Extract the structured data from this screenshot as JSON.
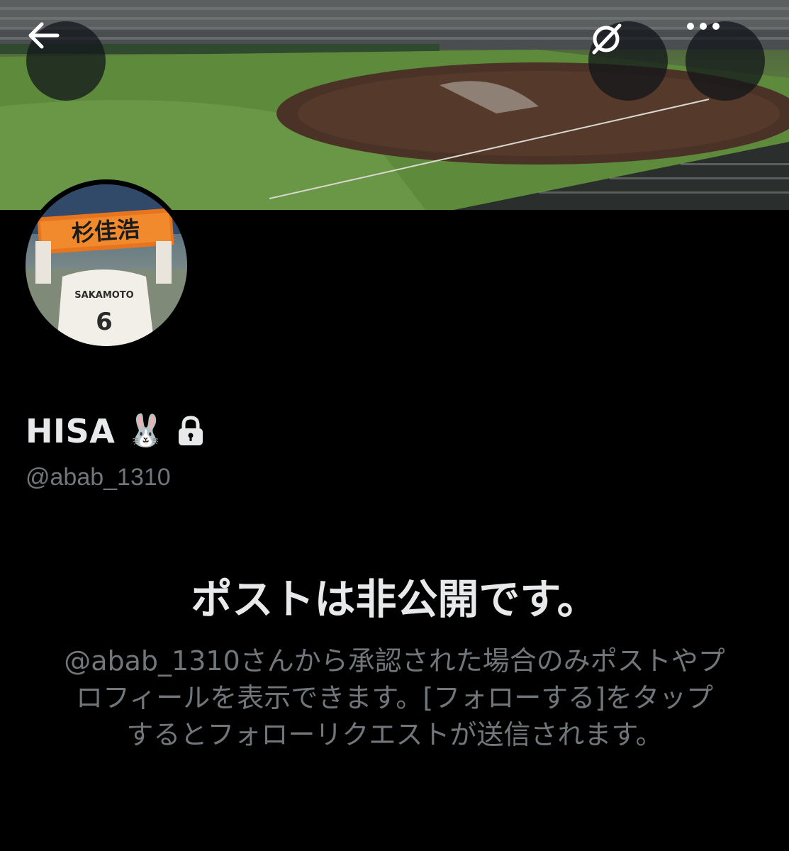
{
  "header": {
    "back_icon": "arrow-left-icon",
    "grok_icon": "grok-icon",
    "more_icon": "more-dots-icon"
  },
  "profile": {
    "display_name": "HISA",
    "name_emoji": "🐰",
    "lock_icon": "lock-icon",
    "handle": "@abab_1310",
    "avatar_banner_text": "杉佳浩",
    "avatar_jersey_name": "SAKAMOTO",
    "avatar_jersey_number": "6"
  },
  "private_notice": {
    "title": "ポストは非公開です。",
    "body": "@abab_1310さんから承認された場合のみポストやプロフィールを表示できます。[フォローする]をタップするとフォローリクエストが送信されます。"
  },
  "colors": {
    "background": "#000000",
    "primary_text": "#e7e9ea",
    "secondary_text": "#71767b",
    "button_overlay": "rgba(15,20,25,0.72)"
  }
}
